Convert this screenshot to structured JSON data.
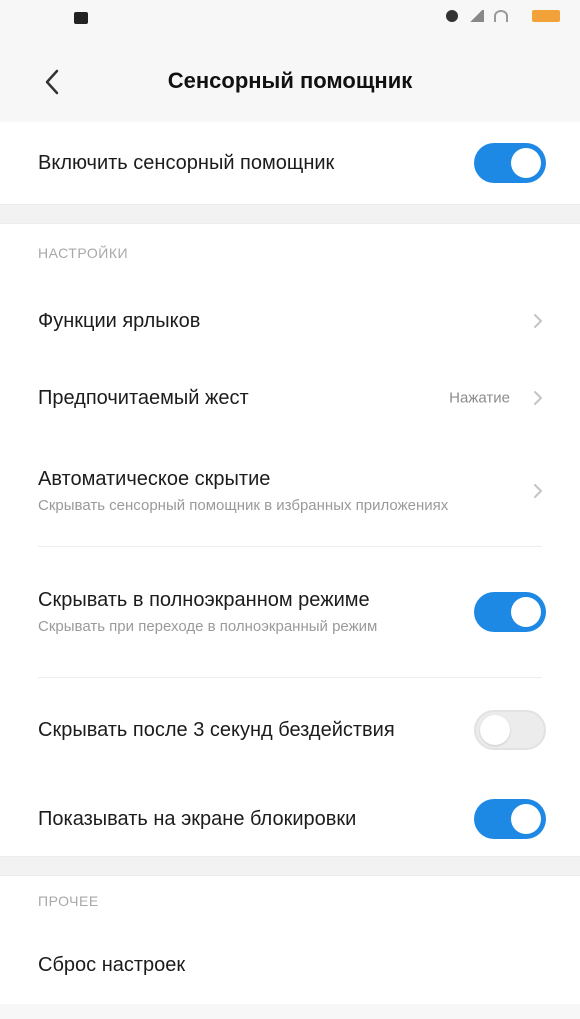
{
  "header": {
    "back_icon": "chevron-left-icon",
    "title": "Сенсорный помощник"
  },
  "main_toggle": {
    "label": "Включить сенсорный помощник",
    "state": true
  },
  "settings_section": {
    "label": "НАСТРОЙКИ",
    "items": [
      {
        "title": "Функции ярлыков",
        "type": "nav"
      },
      {
        "title": "Предпочитаемый жест",
        "value": "Нажатие",
        "type": "nav"
      },
      {
        "title": "Автоматическое скрытие",
        "subtitle": "Скрывать сенсорный помощник в избранных приложениях",
        "type": "nav"
      },
      {
        "title": "Скрывать в полноэкранном режиме",
        "subtitle": "Скрывать при переходе в полноэкранный режим",
        "type": "toggle",
        "state": true
      },
      {
        "title": "Скрывать после 3 секунд бездействия",
        "type": "toggle",
        "state": false
      },
      {
        "title": "Показывать на экране блокировки",
        "type": "toggle",
        "state": true
      }
    ]
  },
  "other_section": {
    "label": "ПРОЧЕЕ",
    "items": [
      {
        "title": "Сброс настроек",
        "type": "nav"
      }
    ]
  },
  "colors": {
    "accent": "#1e88e5",
    "background": "#f7f7f7",
    "card": "#ffffff",
    "battery": "#f3a23a"
  }
}
